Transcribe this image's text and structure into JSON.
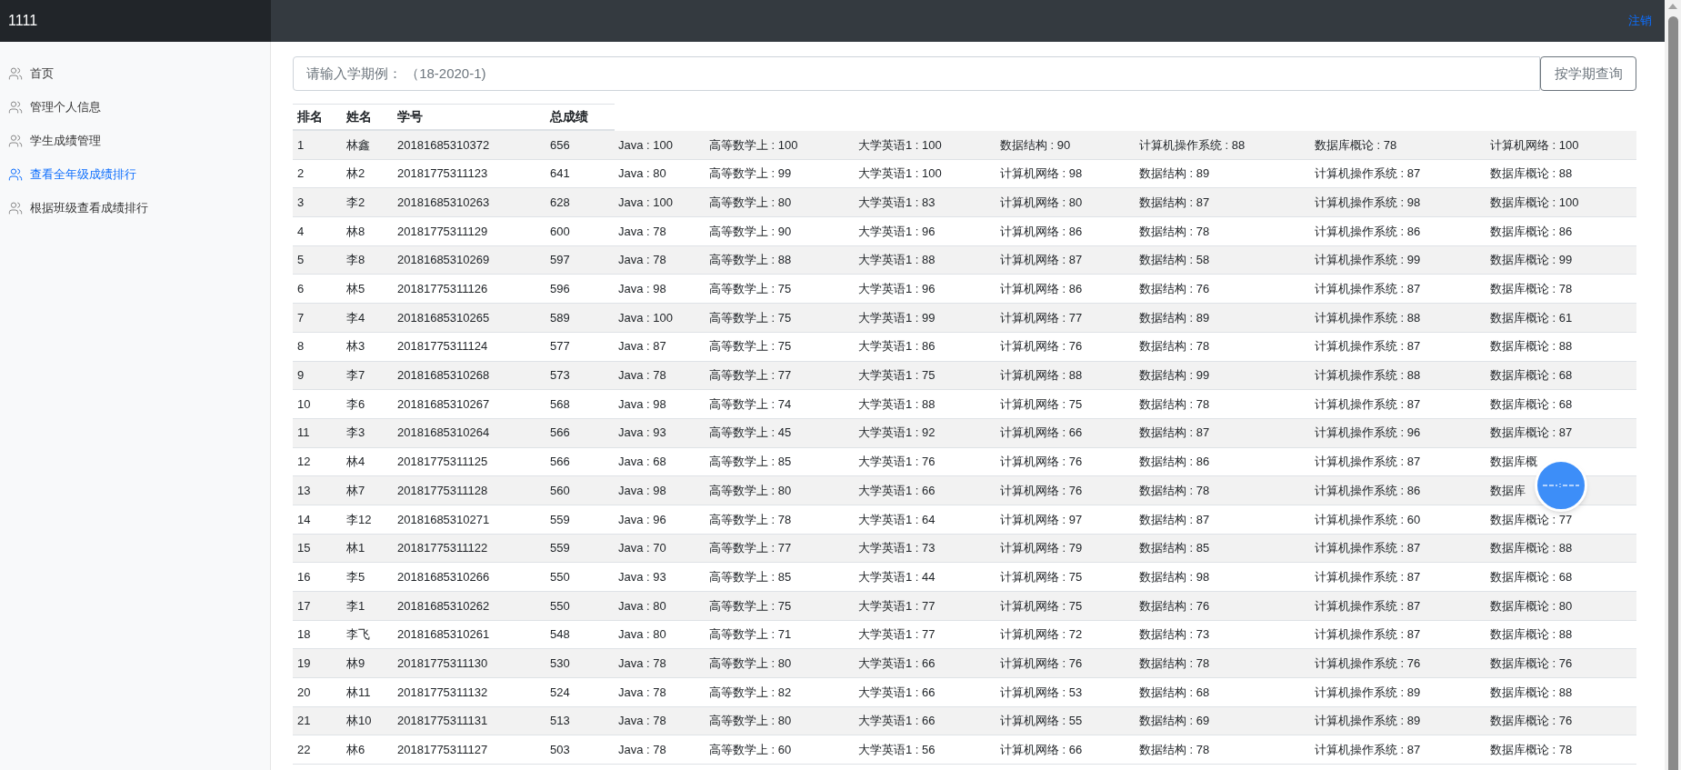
{
  "brand": "1111",
  "logout": "注销",
  "sidebar": {
    "items": [
      {
        "label": "首页",
        "selected": false
      },
      {
        "label": "管理个人信息",
        "selected": false
      },
      {
        "label": "学生成绩管理",
        "selected": false
      },
      {
        "label": "查看全年级成绩排行",
        "selected": true
      },
      {
        "label": "根据班级查看成绩排行",
        "selected": false
      }
    ]
  },
  "search": {
    "placeholder": "请输入学期例： （18-2020-1)",
    "button": "按学期查询"
  },
  "table": {
    "columns": [
      "排名",
      "姓名",
      "学号",
      "总成绩"
    ],
    "rows": [
      {
        "rank": "1",
        "name": "林鑫",
        "student_id": "20181685310372",
        "total": "656",
        "scores": [
          "Java : 100",
          "高等数学上 : 100",
          "大学英语1 : 100",
          "数据结构 : 90",
          "计算机操作系统 : 88",
          "数据库概论 : 78",
          "计算机网络 : 100"
        ]
      },
      {
        "rank": "2",
        "name": "林2",
        "student_id": "20181775311123",
        "total": "641",
        "scores": [
          "Java : 80",
          "高等数学上 : 99",
          "大学英语1 : 100",
          "计算机网络 : 98",
          "数据结构 : 89",
          "计算机操作系统 : 87",
          "数据库概论 : 88"
        ]
      },
      {
        "rank": "3",
        "name": "李2",
        "student_id": "20181685310263",
        "total": "628",
        "scores": [
          "Java : 100",
          "高等数学上 : 80",
          "大学英语1 : 83",
          "计算机网络 : 80",
          "数据结构 : 87",
          "计算机操作系统 : 98",
          "数据库概论 : 100"
        ]
      },
      {
        "rank": "4",
        "name": "林8",
        "student_id": "20181775311129",
        "total": "600",
        "scores": [
          "Java : 78",
          "高等数学上 : 90",
          "大学英语1 : 96",
          "计算机网络 : 86",
          "数据结构 : 78",
          "计算机操作系统 : 86",
          "数据库概论 : 86"
        ]
      },
      {
        "rank": "5",
        "name": "李8",
        "student_id": "20181685310269",
        "total": "597",
        "scores": [
          "Java : 78",
          "高等数学上 : 88",
          "大学英语1 : 88",
          "计算机网络 : 87",
          "数据结构 : 58",
          "计算机操作系统 : 99",
          "数据库概论 : 99"
        ]
      },
      {
        "rank": "6",
        "name": "林5",
        "student_id": "20181775311126",
        "total": "596",
        "scores": [
          "Java : 98",
          "高等数学上 : 75",
          "大学英语1 : 96",
          "计算机网络 : 86",
          "数据结构 : 76",
          "计算机操作系统 : 87",
          "数据库概论 : 78"
        ]
      },
      {
        "rank": "7",
        "name": "李4",
        "student_id": "20181685310265",
        "total": "589",
        "scores": [
          "Java : 100",
          "高等数学上 : 75",
          "大学英语1 : 99",
          "计算机网络 : 77",
          "数据结构 : 89",
          "计算机操作系统 : 88",
          "数据库概论 : 61"
        ]
      },
      {
        "rank": "8",
        "name": "林3",
        "student_id": "20181775311124",
        "total": "577",
        "scores": [
          "Java : 87",
          "高等数学上 : 75",
          "大学英语1 : 86",
          "计算机网络 : 76",
          "数据结构 : 78",
          "计算机操作系统 : 87",
          "数据库概论 : 88"
        ]
      },
      {
        "rank": "9",
        "name": "李7",
        "student_id": "20181685310268",
        "total": "573",
        "scores": [
          "Java : 78",
          "高等数学上 : 77",
          "大学英语1 : 75",
          "计算机网络 : 88",
          "数据结构 : 99",
          "计算机操作系统 : 88",
          "数据库概论 : 68"
        ]
      },
      {
        "rank": "10",
        "name": "李6",
        "student_id": "20181685310267",
        "total": "568",
        "scores": [
          "Java : 98",
          "高等数学上 : 74",
          "大学英语1 : 88",
          "计算机网络 : 75",
          "数据结构 : 78",
          "计算机操作系统 : 87",
          "数据库概论 : 68"
        ]
      },
      {
        "rank": "11",
        "name": "李3",
        "student_id": "20181685310264",
        "total": "566",
        "scores": [
          "Java : 93",
          "高等数学上 : 45",
          "大学英语1 : 92",
          "计算机网络 : 66",
          "数据结构 : 87",
          "计算机操作系统 : 96",
          "数据库概论 : 87"
        ]
      },
      {
        "rank": "12",
        "name": "林4",
        "student_id": "20181775311125",
        "total": "566",
        "scores": [
          "Java : 68",
          "高等数学上 : 85",
          "大学英语1 : 76",
          "计算机网络 : 76",
          "数据结构 : 86",
          "计算机操作系统 : 87",
          "数据库概"
        ]
      },
      {
        "rank": "13",
        "name": "林7",
        "student_id": "20181775311128",
        "total": "560",
        "scores": [
          "Java : 98",
          "高等数学上 : 80",
          "大学英语1 : 66",
          "计算机网络 : 76",
          "数据结构 : 78",
          "计算机操作系统 : 86",
          "数据库"
        ]
      },
      {
        "rank": "14",
        "name": "李12",
        "student_id": "20181685310271",
        "total": "559",
        "scores": [
          "Java : 96",
          "高等数学上 : 78",
          "大学英语1 : 64",
          "计算机网络 : 97",
          "数据结构 : 87",
          "计算机操作系统 : 60",
          "数据库概论 : 77"
        ]
      },
      {
        "rank": "15",
        "name": "林1",
        "student_id": "20181775311122",
        "total": "559",
        "scores": [
          "Java : 70",
          "高等数学上 : 77",
          "大学英语1 : 73",
          "计算机网络 : 79",
          "数据结构 : 85",
          "计算机操作系统 : 87",
          "数据库概论 : 88"
        ]
      },
      {
        "rank": "16",
        "name": "李5",
        "student_id": "20181685310266",
        "total": "550",
        "scores": [
          "Java : 93",
          "高等数学上 : 85",
          "大学英语1 : 44",
          "计算机网络 : 75",
          "数据结构 : 98",
          "计算机操作系统 : 87",
          "数据库概论 : 68"
        ]
      },
      {
        "rank": "17",
        "name": "李1",
        "student_id": "20181685310262",
        "total": "550",
        "scores": [
          "Java : 80",
          "高等数学上 : 75",
          "大学英语1 : 77",
          "计算机网络 : 75",
          "数据结构 : 76",
          "计算机操作系统 : 87",
          "数据库概论 : 80"
        ]
      },
      {
        "rank": "18",
        "name": "李飞",
        "student_id": "20181685310261",
        "total": "548",
        "scores": [
          "Java : 80",
          "高等数学上 : 71",
          "大学英语1 : 77",
          "计算机网络 : 72",
          "数据结构 : 73",
          "计算机操作系统 : 87",
          "数据库概论 : 88"
        ]
      },
      {
        "rank": "19",
        "name": "林9",
        "student_id": "20181775311130",
        "total": "530",
        "scores": [
          "Java : 78",
          "高等数学上 : 80",
          "大学英语1 : 66",
          "计算机网络 : 76",
          "数据结构 : 78",
          "计算机操作系统 : 76",
          "数据库概论 : 76"
        ]
      },
      {
        "rank": "20",
        "name": "林11",
        "student_id": "20181775311132",
        "total": "524",
        "scores": [
          "Java : 78",
          "高等数学上 : 82",
          "大学英语1 : 66",
          "计算机网络 : 53",
          "数据结构 : 68",
          "计算机操作系统 : 89",
          "数据库概论 : 88"
        ]
      },
      {
        "rank": "21",
        "name": "林10",
        "student_id": "20181775311131",
        "total": "513",
        "scores": [
          "Java : 78",
          "高等数学上 : 80",
          "大学英语1 : 66",
          "计算机网络 : 55",
          "数据结构 : 69",
          "计算机操作系统 : 89",
          "数据库概论 : 76"
        ]
      },
      {
        "rank": "22",
        "name": "林6",
        "student_id": "20181775311127",
        "total": "503",
        "scores": [
          "Java : 78",
          "高等数学上 : 60",
          "大学英语1 : 56",
          "计算机网络 : 66",
          "数据结构 : 78",
          "计算机操作系统 : 87",
          "数据库概论 : 78"
        ]
      }
    ]
  }
}
